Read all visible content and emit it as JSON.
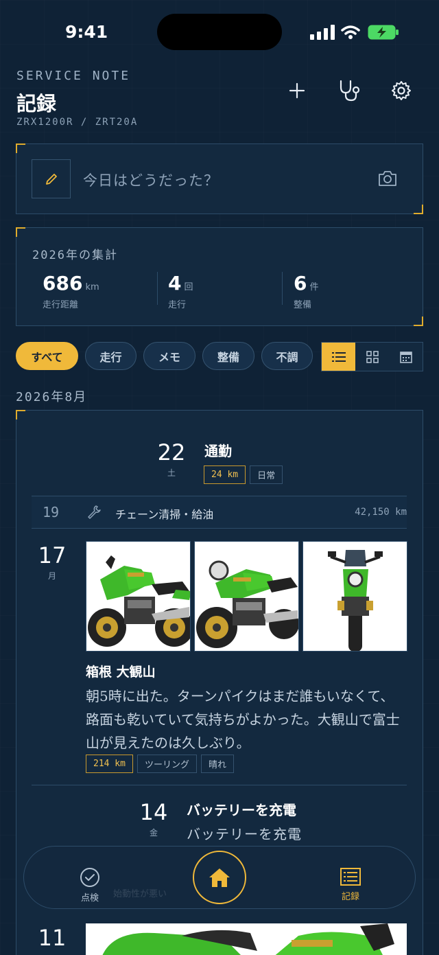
{
  "status": {
    "time": "9:41"
  },
  "header": {
    "kicker": "SERVICE NOTE",
    "title": "記録",
    "subtitle": "ZRX1200R / ZRT20A"
  },
  "composer": {
    "placeholder": "今日はどうだった？"
  },
  "summary": {
    "title": "2026年の集計",
    "stats": [
      {
        "value": "686",
        "unit": "km",
        "label": "走行距離"
      },
      {
        "value": "4",
        "unit": "回",
        "label": "走行"
      },
      {
        "value": "6",
        "unit": "件",
        "label": "整備"
      }
    ]
  },
  "filters": [
    {
      "label": "すべて"
    },
    {
      "label": "走行"
    },
    {
      "label": "メモ"
    },
    {
      "label": "整備"
    },
    {
      "label": "不調"
    }
  ],
  "month": "2026年8月",
  "entries": {
    "e22": {
      "day": "22",
      "weekday": "土",
      "title": "通勤",
      "tags": [
        "24 km",
        "日常"
      ]
    },
    "e19": {
      "day": "19",
      "title": "チェーン清掃・給油",
      "odo": "42,150 km"
    },
    "e17": {
      "day": "17",
      "weekday": "月",
      "title": "箱根 大観山",
      "body": "朝5時に出た。ターンパイクはまだ誰もいなくて、路面も乾いていて気持ちがよかった。大観山で富士山が見えたのは久しぶり。",
      "tags": [
        "214 km",
        "ツーリング",
        "晴れ"
      ]
    },
    "e14": {
      "day": "14",
      "weekday": "金",
      "title": "バッテリーを充電",
      "body": "バッテリーを充電",
      "hidden": "始動性が悪い"
    },
    "e11": {
      "day": "11"
    }
  },
  "tabbar": {
    "left": "点検",
    "right": "記録"
  },
  "colors": {
    "accent": "#f0b93a",
    "background": "#0f2236",
    "bike_green": "#3fb82a"
  }
}
